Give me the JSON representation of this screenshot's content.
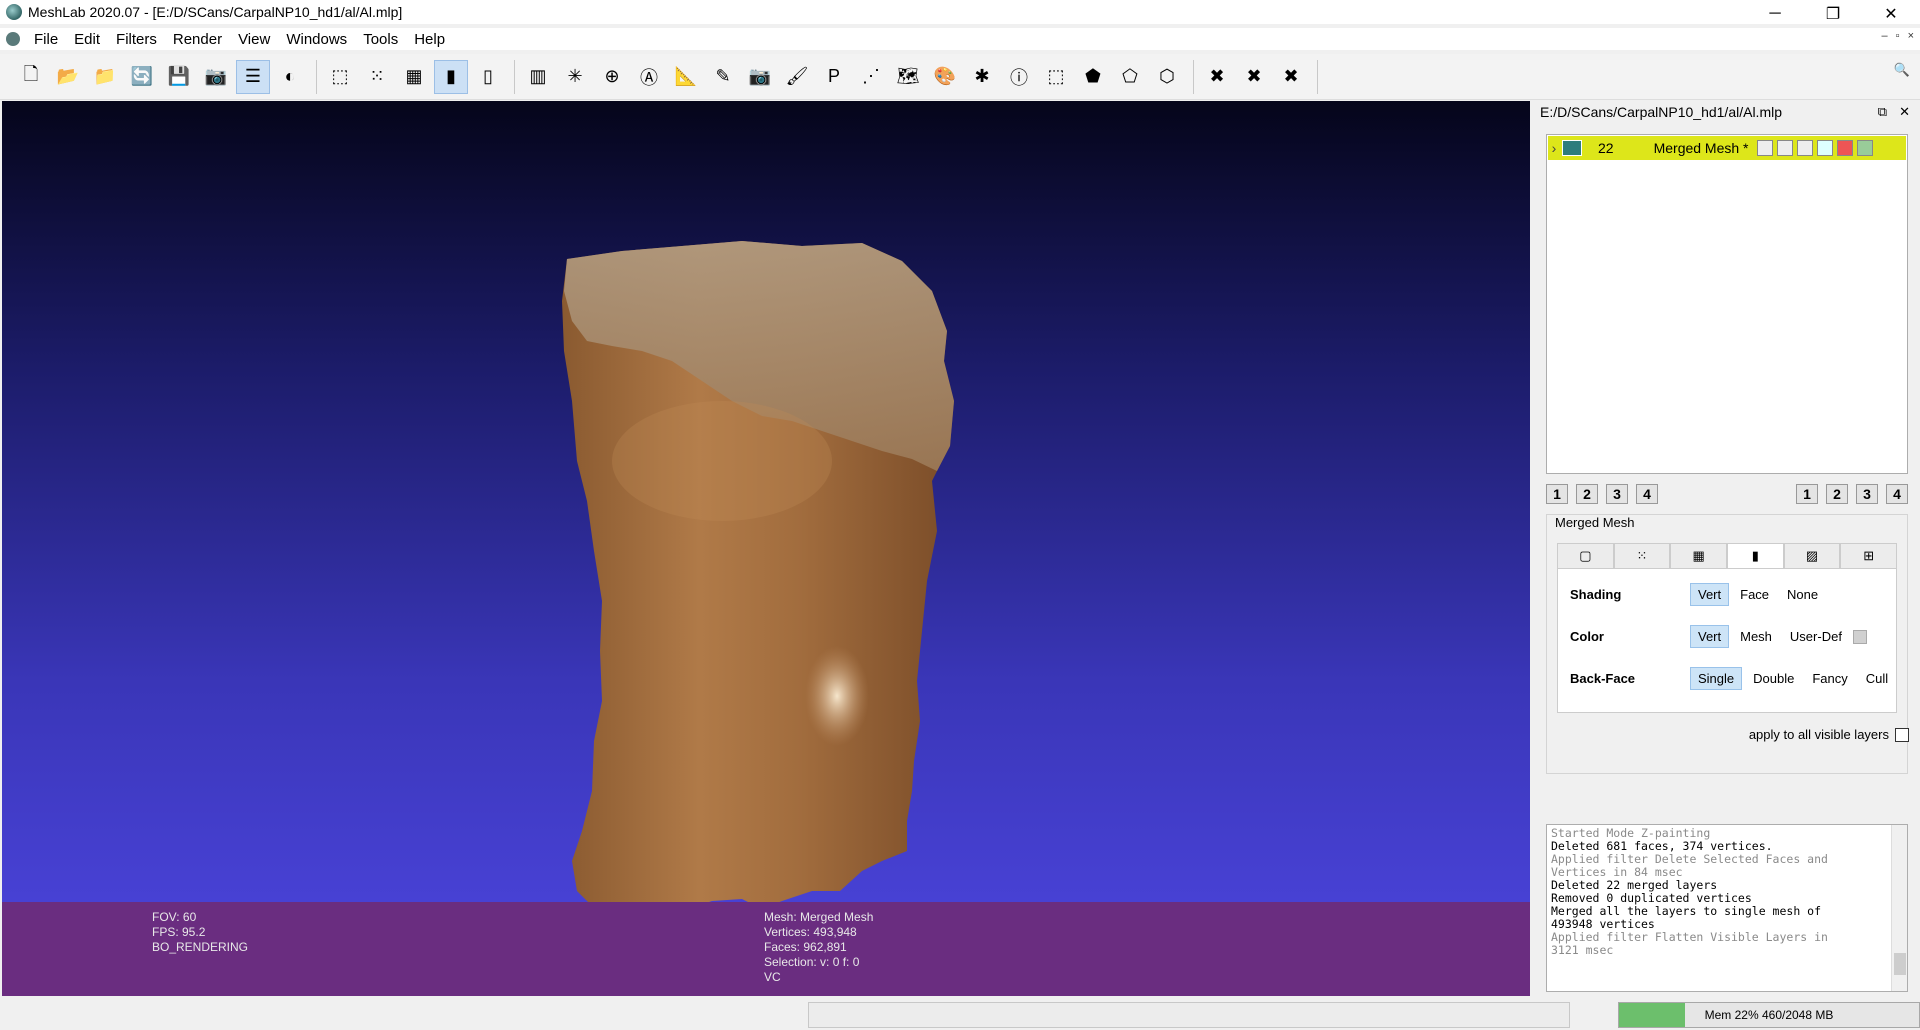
{
  "window": {
    "title": "MeshLab 2020.07 - [E:/D/SCans/CarpalNP10_hd1/al/Al.mlp]",
    "minimize": "─",
    "maximize": "❐",
    "close": "✕"
  },
  "menu": {
    "items": [
      "File",
      "Edit",
      "Filters",
      "Render",
      "View",
      "Windows",
      "Tools",
      "Help"
    ],
    "mdi": [
      "–",
      "▫",
      "×"
    ]
  },
  "toolbar": {
    "buttons": [
      {
        "icon": "new-file-icon",
        "glyph": "🗋"
      },
      {
        "icon": "open-project-icon",
        "glyph": "📂"
      },
      {
        "icon": "open-mesh-icon",
        "glyph": "📁"
      },
      {
        "icon": "reload-icon",
        "glyph": "🔄"
      },
      {
        "icon": "save-icon",
        "glyph": "💾"
      },
      {
        "icon": "snapshot-icon",
        "glyph": "📷"
      },
      {
        "icon": "layers-icon",
        "glyph": "☰",
        "active": true
      },
      {
        "icon": "raster-icon",
        "glyph": "◐"
      }
    ],
    "render_buttons": [
      {
        "icon": "bbox-icon",
        "glyph": "⬚"
      },
      {
        "icon": "points-icon",
        "glyph": "⁙"
      },
      {
        "icon": "wireframe-icon",
        "glyph": "▦"
      },
      {
        "icon": "smooth-icon",
        "glyph": "▮",
        "active": true
      },
      {
        "icon": "texture-icon",
        "glyph": "▯"
      }
    ],
    "edit_buttons": [
      {
        "icon": "manipulator-icon",
        "glyph": "▥"
      },
      {
        "icon": "align-icon",
        "glyph": "✳"
      },
      {
        "icon": "sphere-icon",
        "glyph": "⊕"
      },
      {
        "icon": "annotate-icon",
        "glyph": "Ⓐ"
      },
      {
        "icon": "measure-icon",
        "glyph": "📐"
      },
      {
        "icon": "pick-icon",
        "glyph": "✎"
      },
      {
        "icon": "raster-align-icon",
        "glyph": "📷"
      },
      {
        "icon": "paint-icon",
        "glyph": "🖌"
      },
      {
        "icon": "z-paint-icon",
        "glyph": "P"
      },
      {
        "icon": "point-picker-icon",
        "glyph": "⋰"
      },
      {
        "icon": "texture-map-icon",
        "glyph": "🗺"
      },
      {
        "icon": "quality-icon",
        "glyph": "🎨"
      },
      {
        "icon": "georef-icon",
        "glyph": "✱"
      },
      {
        "icon": "info-icon",
        "glyph": "ⓘ"
      },
      {
        "icon": "select-rect-icon",
        "glyph": "⬚"
      },
      {
        "icon": "select-vert-icon",
        "glyph": "⬟"
      },
      {
        "icon": "select-conn-icon",
        "glyph": "⬠"
      },
      {
        "icon": "select-area-icon",
        "glyph": "⬡"
      }
    ],
    "delete_buttons": [
      {
        "icon": "delete-verts-icon",
        "glyph": "✖"
      },
      {
        "icon": "delete-faces-icon",
        "glyph": "✖"
      },
      {
        "icon": "delete-faces-verts-icon",
        "glyph": "✖"
      }
    ],
    "search": "🔍"
  },
  "viewport": {
    "info_left": [
      "FOV: 60",
      "FPS:    95.2",
      "BO_RENDERING"
    ],
    "info_mid": [
      "Mesh: Merged Mesh",
      "Vertices: 493,948",
      "Faces: 962,891",
      "Selection: v: 0 f: 0",
      "VC"
    ]
  },
  "panel": {
    "title": "E:/D/SCans/CarpalNP10_hd1/al/Al.mlp",
    "float_icon": "⧉",
    "close_icon": "✕",
    "layer": {
      "expand": "›",
      "number": "22",
      "name": "Merged Mesh *"
    },
    "numsets": [
      "1",
      "2",
      "3",
      "4"
    ],
    "render_title": "Merged Mesh",
    "tab_glyphs": [
      "▢",
      "⁙",
      "▦",
      "▮",
      "▨",
      "⊞"
    ],
    "shading": {
      "label": "Shading",
      "options": [
        "Vert",
        "Face",
        "None"
      ],
      "selected": "Vert"
    },
    "color": {
      "label": "Color",
      "options": [
        "Vert",
        "Mesh",
        "User-Def"
      ],
      "selected": "Vert"
    },
    "backface": {
      "label": "Back-Face",
      "options": [
        "Single",
        "Double",
        "Fancy",
        "Cull"
      ],
      "selected": "Single"
    },
    "apply_all": "apply to all visible layers"
  },
  "log": [
    {
      "text": "Started Mode Z-painting",
      "gray": true
    },
    {
      "text": "Deleted 681 faces, 374 vertices.",
      "gray": false
    },
    {
      "text": "Applied filter Delete Selected Faces and",
      "gray": true
    },
    {
      "text": "Vertices in 84 msec",
      "gray": true
    },
    {
      "text": "Deleted 22 merged layers",
      "gray": false
    },
    {
      "text": "Removed 0 duplicated vertices",
      "gray": false
    },
    {
      "text": "Merged all the layers to single mesh of",
      "gray": false
    },
    {
      "text": "493948 vertices",
      "gray": false
    },
    {
      "text": "Applied filter Flatten Visible Layers in",
      "gray": true
    },
    {
      "text": "3121 msec",
      "gray": true
    }
  ],
  "status": {
    "memory_text": "Mem 22% 460/2048 MB",
    "memory_used_fraction": 0.22
  }
}
